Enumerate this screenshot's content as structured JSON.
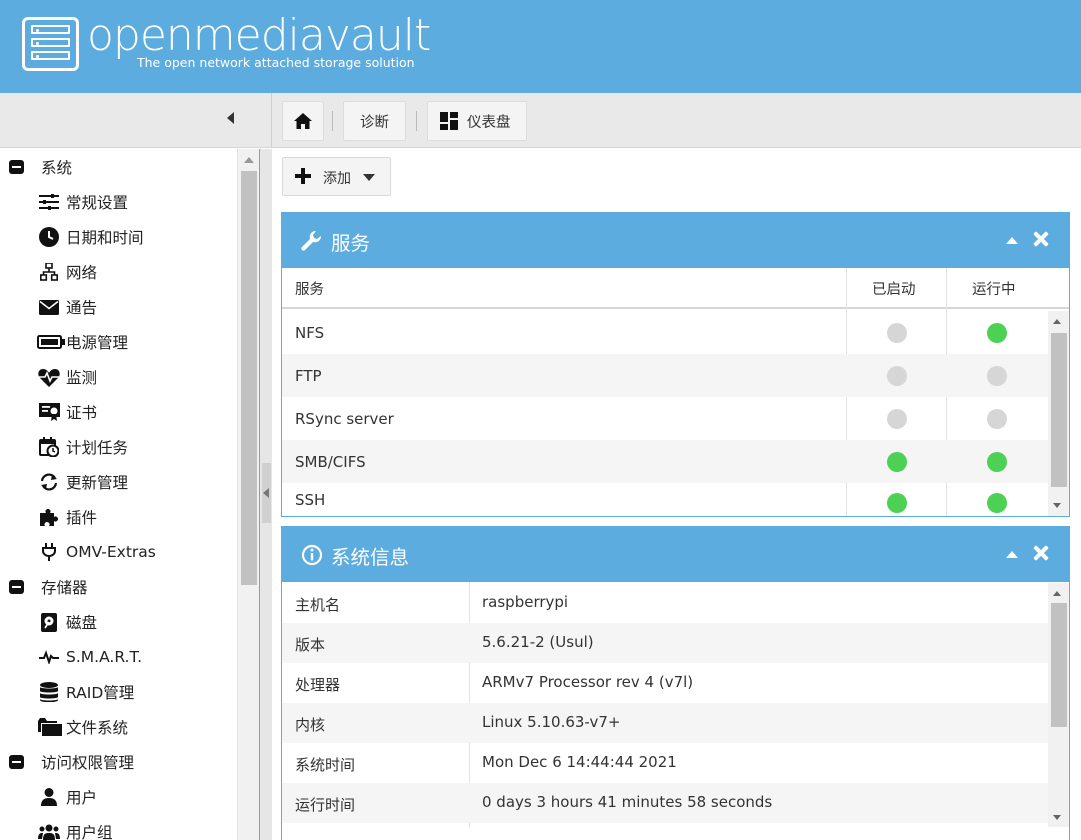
{
  "header": {
    "brand": "openmediavault",
    "tagline": "The open network attached storage solution",
    "bg_color": "#5cacdf"
  },
  "toolbar": {
    "home_icon": "home-icon",
    "diagnostics_label": "诊断",
    "dashboard_label": "仪表盘",
    "dashboard_icon": "dashboard-icon"
  },
  "sidebar": {
    "groups": [
      {
        "label": "系统"
      },
      {
        "label": "存储器"
      },
      {
        "label": "访问权限管理"
      }
    ],
    "items": [
      {
        "label": "常规设置",
        "icon": "sliders-icon"
      },
      {
        "label": "日期和时间",
        "icon": "clock-icon"
      },
      {
        "label": "网络",
        "icon": "network-icon"
      },
      {
        "label": "通告",
        "icon": "envelope-icon"
      },
      {
        "label": "电源管理",
        "icon": "battery-icon"
      },
      {
        "label": "监测",
        "icon": "heartbeat-icon"
      },
      {
        "label": "证书",
        "icon": "certificate-icon"
      },
      {
        "label": "计划任务",
        "icon": "calendar-clock-icon"
      },
      {
        "label": "更新管理",
        "icon": "refresh-icon"
      },
      {
        "label": "插件",
        "icon": "puzzle-icon"
      },
      {
        "label": "OMV-Extras",
        "icon": "plug-icon"
      },
      {
        "label": "磁盘",
        "icon": "disk-icon"
      },
      {
        "label": "S.M.A.R.T.",
        "icon": "pulse-icon"
      },
      {
        "label": "RAID管理",
        "icon": "database-icon"
      },
      {
        "label": "文件系统",
        "icon": "folder-icon"
      },
      {
        "label": "用户",
        "icon": "user-icon"
      },
      {
        "label": "用户组",
        "icon": "users-icon"
      }
    ]
  },
  "main": {
    "add_label": "添加",
    "services_panel": {
      "title": "服务",
      "icon": "wrench-icon",
      "columns": [
        "服务",
        "已启动",
        "运行中"
      ],
      "rows": [
        {
          "name": "NFS",
          "enabled": false,
          "running": true
        },
        {
          "name": "FTP",
          "enabled": false,
          "running": false
        },
        {
          "name": "RSync server",
          "enabled": false,
          "running": false
        },
        {
          "name": "SMB/CIFS",
          "enabled": true,
          "running": true
        },
        {
          "name": "SSH",
          "enabled": true,
          "running": true
        }
      ],
      "on_color": "#4cd154",
      "off_color": "#d6d6d6"
    },
    "sysinfo_panel": {
      "title": "系统信息",
      "icon": "info-icon",
      "rows": [
        {
          "key": "主机名",
          "value": "raspberrypi"
        },
        {
          "key": "版本",
          "value": "5.6.21-2 (Usul)"
        },
        {
          "key": "处理器",
          "value": "ARMv7 Processor rev 4 (v7l)"
        },
        {
          "key": "内核",
          "value": "Linux 5.10.63-v7+"
        },
        {
          "key": "系统时间",
          "value": "Mon Dec 6 14:44:44 2021"
        },
        {
          "key": "运行时间",
          "value": "0 days 3 hours 41 minutes 58 seconds"
        }
      ]
    }
  }
}
